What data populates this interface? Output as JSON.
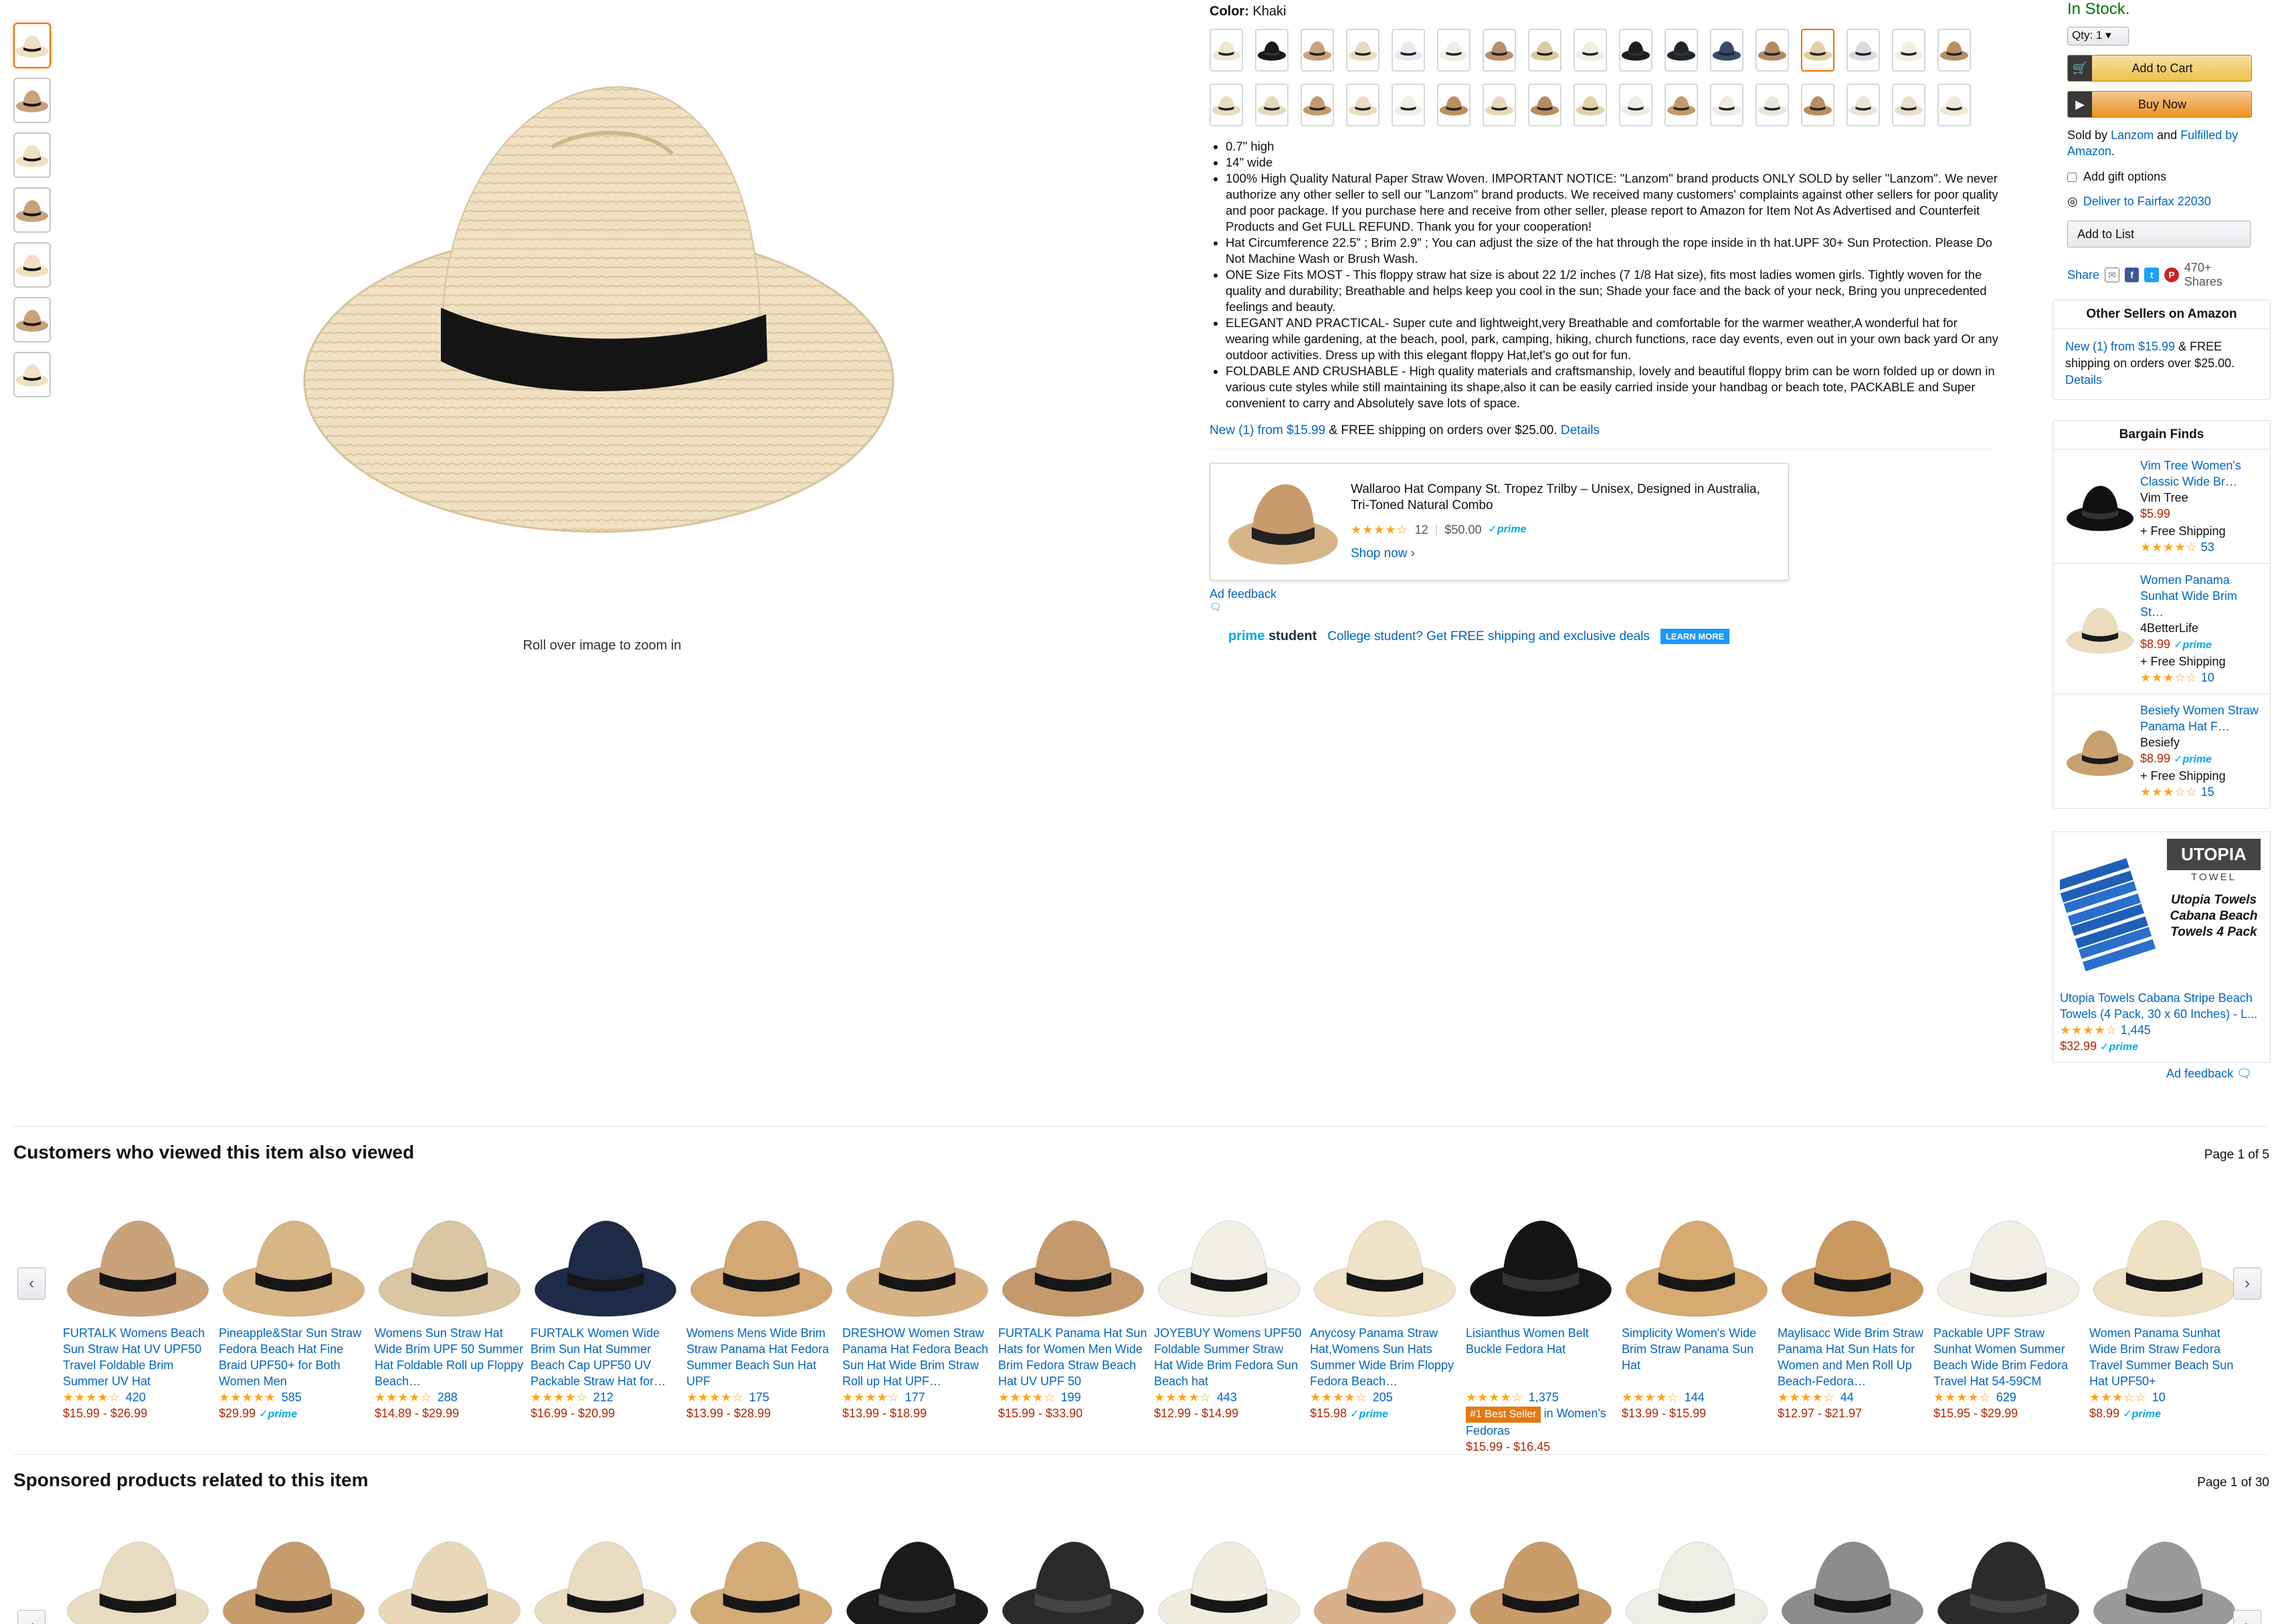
{
  "gallery": {
    "thumbnails": [
      "hat-front",
      "model-1",
      "model-2",
      "hat-top",
      "hat-brown",
      "model-3",
      "model-4"
    ],
    "zoom_hint": "Roll over image to zoom in",
    "main_color": "#efe1c2",
    "band_color": "#111111"
  },
  "product": {
    "color_label": "Color:",
    "color_value": "Khaki",
    "swatch_colors": [
      "#efe7d4",
      "#16181c",
      "#c9a27a",
      "#e8dcc0",
      "#e8eaf2",
      "#f0efe4",
      "#b99067",
      "#dccaa0",
      "#f1efe2",
      "#1c1d20",
      "#1f232b",
      "#3a4a6c",
      "#b48c62",
      "#e2cfa6",
      "#d8dbe3",
      "#f2efe0",
      "#b98f62",
      "#e8dcc0",
      "#e6d9bd",
      "#c49a6c",
      "#eadcc0",
      "#f1efe5",
      "#bd8d5c",
      "#e8d8b8",
      "#b98c5f",
      "#e3d1a8",
      "#efece2",
      "#c39a6b",
      "#efebe0",
      "#e9e6dc",
      "#ba8e62",
      "#ece4d2",
      "#e9dfcc",
      "#f1e8d6"
    ],
    "selected_swatch_index": 13,
    "bullets": [
      "0.7\" high",
      "14\" wide",
      "100% High Quality Natural Paper Straw Woven. IMPORTANT NOTICE: \"Lanzom\" brand products ONLY SOLD by seller \"Lanzom\". We never authorize any other seller to sell our \"Lanzom\" brand products. We received many customers' complaints against other sellers for poor quality and poor package. If you purchase here and receive from other seller, please report to Amazon for Item Not As Advertised and Counterfeit Products and Get FULL REFUND. Thank you for your cooperation!",
      "Hat Circumference 22.5\" ; Brim 2.9\" ; You can adjust the size of the hat through the rope inside in th hat.UPF 30+ Sun Protection. Please Do Not Machine Wash or Brush Wash.",
      "ONE Size Fits MOST - This floppy straw hat size is about 22 1/2 inches (7 1/8 Hat size), fits most ladies women girls. Tightly woven for the quality and durability; Breathable and helps keep you cool in the sun; Shade your face and the back of your neck, Bring you unprecedented feelings and beauty.",
      "ELEGANT AND PRACTICAL- Super cute and lightweight,very Breathable and comfortable for the warmer weather,A wonderful hat for wearing while gardening, at the beach, pool, park, camping, hiking, church functions, race day events, even out in your own back yard Or any outdoor activities. Dress up with this elegant floppy Hat,let's go out for fun.",
      "FOLDABLE AND CRUSHABLE - High quality materials and craftsmanship, lovely and beautiful floppy brim can be worn folded up or down in various cute styles while still maintaining its shape,also it can be easily carried inside your handbag or beach tote, PACKABLE and Super convenient to carry and Absolutely save lots of space."
    ],
    "new_from_link": "New (1) from $15.99",
    "new_from_rest": "& FREE shipping on orders over $25.00.",
    "details_link": "Details"
  },
  "sponsored_ad": {
    "title": "Wallaroo Hat Company St. Tropez Trilby – Unisex, Designed in Australia, Tri-Toned Natural Combo",
    "stars": "★★★★☆",
    "rating_count": "12",
    "price": "$50.00",
    "prime": "✓prime",
    "cta": "Shop now ›",
    "feedback": "Ad feedback"
  },
  "prime_student": {
    "logo_a": "prime",
    "logo_b": "student",
    "text": "College student? Get FREE shipping and exclusive deals",
    "button": "LEARN MORE"
  },
  "buybox": {
    "stock": "In Stock.",
    "qty": "Qty: 1",
    "add_to_cart": "Add to Cart",
    "buy_now": "Buy Now",
    "sold_by_prefix": "Sold by",
    "seller": "Lanzom",
    "and": "and",
    "fulfilled": "Fulfilled by Amazon",
    "period": ".",
    "gift": "Add gift options",
    "deliver": "Deliver to Fairfax 22030",
    "add_to_list": "Add to List",
    "share": "Share",
    "shares": "470+ Shares"
  },
  "other_sellers": {
    "title": "Other Sellers on Amazon",
    "link": "New (1) from $15.99",
    "rest": "& FREE shipping on orders over $25.00.",
    "details": "Details"
  },
  "bargain": {
    "title": "Bargain Finds",
    "items": [
      {
        "title": "Vim Tree Women's Classic Wide Br…",
        "brand": "Vim Tree",
        "price": "$5.99",
        "prime": "",
        "ship": "+ Free Shipping",
        "stars": "★★★★☆",
        "count": "53",
        "color": "#111111"
      },
      {
        "title": "Women Panama Sunhat Wide Brim St…",
        "brand": "4BetterLife",
        "price": "$8.99",
        "prime": "✓prime",
        "ship": "+ Free Shipping",
        "stars": "★★★☆☆",
        "count": "10",
        "color": "#eadcbc"
      },
      {
        "title": "Besiefy Women Straw Panama Hat F…",
        "brand": "Besiefy",
        "price": "$8.99",
        "prime": "✓prime",
        "ship": "+ Free Shipping",
        "stars": "★★★☆☆",
        "count": "15",
        "color": "#c8a06e"
      }
    ]
  },
  "utopia_ad": {
    "brand": "UTOPIA",
    "brand_sub": "TOWEL",
    "tagline": "Utopia Towels Cabana Beach Towels 4 Pack",
    "title": "Utopia Towels Cabana Stripe Beach Towels (4 Pack, 30 x 60 Inches) - L...",
    "stars": "★★★★☆",
    "count": "1,445",
    "price": "$32.99",
    "prime": "✓prime",
    "feedback": "Ad feedback"
  },
  "also_viewed": {
    "title": "Customers who viewed this item also viewed",
    "page": "Page 1 of 5",
    "items": [
      {
        "title": "FURTALK Womens Beach Sun Straw Hat UV UPF50 Travel Foldable Brim Summer UV Hat",
        "stars": "★★★★☆",
        "count": "420",
        "price": "$15.99 - $26.99",
        "prime": "",
        "badge": "",
        "badge_tail": "",
        "color": "#c9a27a"
      },
      {
        "title": "Pineapple&Star Sun Straw Fedora Beach Hat Fine Braid UPF50+ for Both Women Men",
        "stars": "★★★★★",
        "count": "585",
        "price": "$29.99",
        "prime": "✓prime",
        "badge": "",
        "badge_tail": "",
        "color": "#d8b584"
      },
      {
        "title": "Womens Sun Straw Hat Wide Brim UPF 50 Summer Hat Foldable Roll up Floppy Beach…",
        "stars": "★★★★☆",
        "count": "288",
        "price": "$14.89 - $29.99",
        "prime": "",
        "badge": "",
        "badge_tail": "",
        "color": "#d9c6a2"
      },
      {
        "title": "FURTALK Women Wide Brim Sun Hat Summer Beach Cap UPF50 UV Packable Straw Hat for…",
        "stars": "★★★★☆",
        "count": "212",
        "price": "$16.99 - $20.99",
        "prime": "",
        "badge": "",
        "badge_tail": "",
        "color": "#1e2b48"
      },
      {
        "title": "Womens Mens Wide Brim Straw Panama Hat Fedora Summer Beach Sun Hat UPF",
        "stars": "★★★★☆",
        "count": "175",
        "price": "$13.99 - $28.99",
        "prime": "",
        "badge": "",
        "badge_tail": "",
        "color": "#d2a874"
      },
      {
        "title": "DRESHOW Women Straw Panama Hat Fedora Beach Sun Hat Wide Brim Straw Roll up Hat UPF…",
        "stars": "★★★★☆",
        "count": "177",
        "price": "$13.99 - $18.99",
        "prime": "",
        "badge": "",
        "badge_tail": "",
        "color": "#d6b284"
      },
      {
        "title": "FURTALK Panama Hat Sun Hats for Women Men Wide Brim Fedora Straw Beach Hat UV UPF 50",
        "stars": "★★★★☆",
        "count": "199",
        "price": "$15.99 - $33.90",
        "prime": "",
        "badge": "",
        "badge_tail": "",
        "color": "#c49a6c"
      },
      {
        "title": "JOYEBUY Womens UPF50 Foldable Summer Straw Hat Wide Brim Fedora Sun Beach hat",
        "stars": "★★★★☆",
        "count": "443",
        "price": "$12.99 - $14.99",
        "prime": "",
        "badge": "",
        "badge_tail": "",
        "color": "#f1efe6"
      },
      {
        "title": "Anycosy Panama Straw Hat,Womens Sun Hats Summer Wide Brim Floppy Fedora Beach…",
        "stars": "★★★★☆",
        "count": "205",
        "price": "$15.98",
        "prime": "✓prime",
        "badge": "",
        "badge_tail": "",
        "color": "#efe2c6"
      },
      {
        "title": "Lisianthus Women Belt Buckle Fedora Hat",
        "stars": "★★★★☆",
        "count": "1,375",
        "price": "$15.99 - $16.45",
        "prime": "",
        "badge": "#1 Best Seller",
        "badge_tail": "in Women's Fedoras",
        "color": "#141414"
      },
      {
        "title": "Simplicity Women's Wide Brim Straw Panama Sun Hat",
        "stars": "★★★★☆",
        "count": "144",
        "price": "$13.99 - $15.99",
        "prime": "",
        "badge": "",
        "badge_tail": "",
        "color": "#d6aa70"
      },
      {
        "title": "Maylisacc Wide Brim Straw Panama Hat Sun Hats for Women and Men Roll Up Beach-Fedora…",
        "stars": "★★★★☆",
        "count": "44",
        "price": "$12.97 - $21.97",
        "prime": "",
        "badge": "",
        "badge_tail": "",
        "color": "#c9995f"
      },
      {
        "title": "Packable UPF Straw Sunhat Women Summer Beach Wide Brim Fedora Travel Hat 54-59CM",
        "stars": "★★★★☆",
        "count": "629",
        "price": "$15.95 - $29.99",
        "prime": "",
        "badge": "",
        "badge_tail": "",
        "color": "#f1efe6"
      },
      {
        "title": "Women Panama Sunhat Wide Brim Straw Fedora Travel Summer Beach Sun Hat UPF50+",
        "stars": "★★★☆☆",
        "count": "10",
        "price": "$8.99",
        "prime": "✓prime",
        "badge": "",
        "badge_tail": "",
        "color": "#efe1c4"
      }
    ]
  },
  "sponsored_related": {
    "title": "Sponsored products related to this item",
    "page": "Page 1 of 30",
    "item_colors": [
      "#e9dcc0",
      "#c69c6c",
      "#e9d8b8",
      "#eadcc0",
      "#d3ac78",
      "#1a1a1a",
      "#2a2a2a",
      "#f1ece0",
      "#d9b08a",
      "#c99c6a",
      "#efeee6",
      "#8c8c8c",
      "#2b2b2b",
      "#9a9a9a"
    ]
  }
}
